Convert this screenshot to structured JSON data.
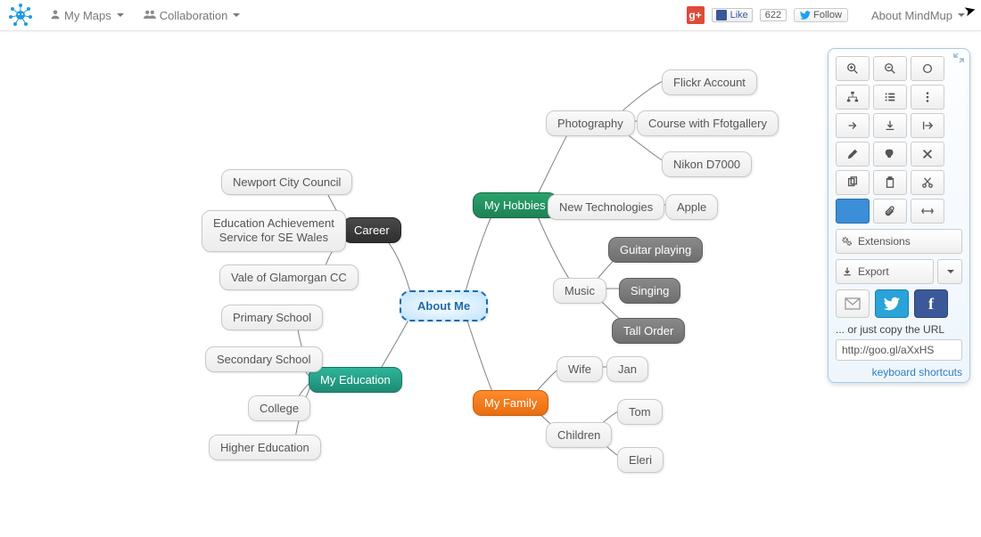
{
  "navbar": {
    "my_maps": "My Maps",
    "collab": "Collaboration",
    "fb_like": "Like",
    "fb_count": "622",
    "tw_follow": "Follow",
    "about": "About MindMup"
  },
  "map": {
    "root": "About Me",
    "branches": {
      "career": {
        "label": "Career",
        "items": [
          "Newport City Council",
          "Education Achievement\nService for SE Wales",
          "Vale of Glamorgan CC"
        ]
      },
      "education": {
        "label": "My Education",
        "items": [
          "Primary School",
          "Secondary School",
          "College",
          "Higher Education"
        ]
      },
      "hobbies": {
        "label": "My Hobbies",
        "children": {
          "photography": {
            "label": "Photography",
            "items": [
              "Flickr Account",
              "Course with Ffotgallery",
              "Nikon D7000"
            ]
          },
          "newtech": {
            "label": "New Technologies",
            "items": [
              "Apple"
            ]
          },
          "music": {
            "label": "Music",
            "items": [
              "Guitar playing",
              "Singing",
              "Tall Order"
            ]
          }
        }
      },
      "family": {
        "label": "My Family",
        "children": {
          "wife": {
            "label": "Wife",
            "items": [
              "Jan"
            ]
          },
          "children": {
            "label": "Children",
            "items": [
              "Tom",
              "Eleri"
            ]
          }
        }
      }
    }
  },
  "panel": {
    "extensions_label": "Extensions",
    "export_label": "Export",
    "share_hint": "... or just copy the URL",
    "url_value": "http://goo.gl/aXxHS",
    "kbd_link": "keyboard shortcuts"
  }
}
